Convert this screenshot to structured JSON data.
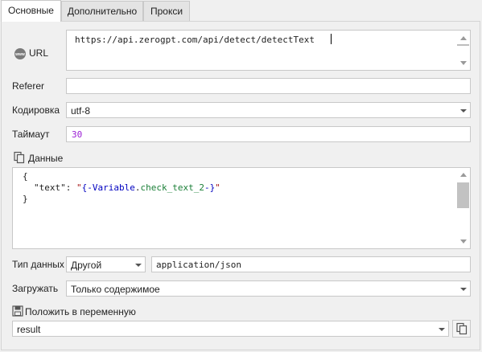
{
  "tabs": [
    {
      "label": "Основные",
      "active": true
    },
    {
      "label": "Дополнительно",
      "active": false
    },
    {
      "label": "Прокси",
      "active": false
    }
  ],
  "url": {
    "label": "URL",
    "icon": "www-globe-icon",
    "value": "https://api.zerogpt.com/api/detect/detectText"
  },
  "referer": {
    "label": "Referer",
    "value": ""
  },
  "encoding": {
    "label": "Кодировка",
    "value": "utf-8"
  },
  "timeout": {
    "label": "Таймаут",
    "value": "30"
  },
  "data": {
    "label": "Данные",
    "icon": "copy-icon",
    "lines": {
      "open_brace": "{",
      "key": "\"text\"",
      "colon": ": ",
      "quote_open": "\"",
      "var_open": "{-",
      "var_name_prefix": "Variable",
      "var_dot": ".",
      "var_name": "check_text_2",
      "var_close": "-}",
      "quote_close": "\"",
      "close_brace": "}"
    }
  },
  "data_type": {
    "label": "Тип данных",
    "type_value": "Другой",
    "content_type": "application/json"
  },
  "load": {
    "label": "Загружать",
    "value": "Только содержимое"
  },
  "save_to_var": {
    "label": "Положить в переменную",
    "icon": "save-icon",
    "value": "result",
    "copy_icon": "copy-icon"
  },
  "colors": {
    "accent_number": "#9b1fd4",
    "string": "#a31515",
    "variable": "#1a7f37"
  }
}
